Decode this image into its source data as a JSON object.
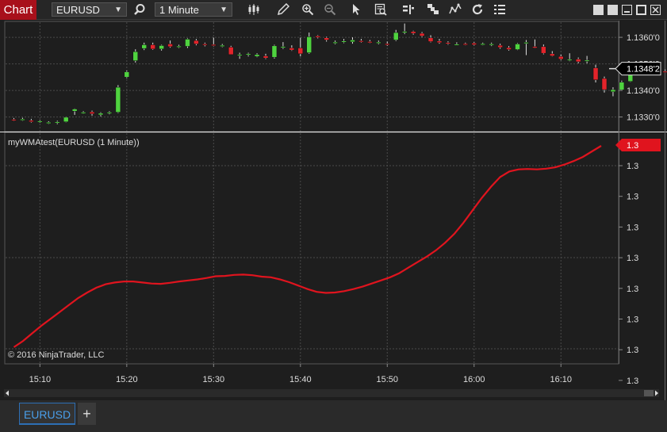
{
  "toolbar": {
    "chart_tab": "Chart",
    "instrument": "EURUSD",
    "interval": "1 Minute",
    "icons": [
      "search-icon",
      "bar-type-icon",
      "draw-tool-icon",
      "zoom-in-icon",
      "zoom-out-icon",
      "pointer-icon",
      "data-box-icon",
      "strategy-icon",
      "properties-icon",
      "indicator-icon",
      "reload-icon",
      "list-icon"
    ]
  },
  "window_buttons": [
    "restore-icon",
    "tile-icon",
    "minimize-icon",
    "maximize-icon",
    "close-icon"
  ],
  "chart_data": [
    {
      "type": "candlestick",
      "instrument": "EURUSD",
      "interval": "1 Minute",
      "price_axis": {
        "labels": [
          "1.1360'0",
          "1.1350'0",
          "1.1340'0",
          "1.1330'0"
        ],
        "values": [
          1.136,
          1.135,
          1.134,
          1.133
        ],
        "range": [
          1.13254,
          1.13654
        ],
        "current": 1.13482,
        "current_label": "1.1348'2"
      },
      "candles": [
        [
          1.13291,
          1.13296,
          1.13285,
          1.13288
        ],
        [
          1.1329,
          1.13297,
          1.13286,
          1.13292
        ],
        [
          1.13287,
          1.13293,
          1.13279,
          1.13282
        ],
        [
          1.13283,
          1.13289,
          1.13278,
          1.13285
        ],
        [
          1.13279,
          1.13284,
          1.13274,
          1.1328
        ],
        [
          1.13279,
          1.13286,
          1.13273,
          1.13282
        ],
        [
          1.13282,
          1.13301,
          1.1328,
          1.13299
        ],
        [
          1.13322,
          1.13332,
          1.13308,
          1.1333
        ],
        [
          1.13317,
          1.13322,
          1.13312,
          1.13318
        ],
        [
          1.13319,
          1.13324,
          1.13305,
          1.13312
        ],
        [
          1.13308,
          1.13318,
          1.13302,
          1.13314
        ],
        [
          1.13316,
          1.13322,
          1.1331,
          1.13318
        ],
        [
          1.13318,
          1.1342,
          1.13315,
          1.13412
        ],
        [
          1.1345,
          1.13475,
          1.13446,
          1.1347
        ],
        [
          1.13512,
          1.13555,
          1.13505,
          1.13546
        ],
        [
          1.13558,
          1.1358,
          1.13552,
          1.13572
        ],
        [
          1.13572,
          1.1358,
          1.13553,
          1.13556
        ],
        [
          1.13556,
          1.13572,
          1.1355,
          1.13569
        ],
        [
          1.13575,
          1.13588,
          1.13561,
          1.13565
        ],
        [
          1.13566,
          1.13572,
          1.1356,
          1.13567
        ],
        [
          1.13566,
          1.13596,
          1.1356,
          1.13593
        ],
        [
          1.13588,
          1.13594,
          1.1357,
          1.13575
        ],
        [
          1.13575,
          1.1358,
          1.13566,
          1.13572
        ],
        [
          1.13573,
          1.13599,
          1.13566,
          1.13569
        ],
        [
          1.13568,
          1.13575,
          1.13563,
          1.1357
        ],
        [
          1.13563,
          1.13568,
          1.13542,
          1.13535
        ],
        [
          1.13532,
          1.13542,
          1.13519,
          1.13535
        ],
        [
          1.13534,
          1.13542,
          1.13528,
          1.13538
        ],
        [
          1.13528,
          1.1354,
          1.13525,
          1.13535
        ],
        [
          1.1353,
          1.13538,
          1.13518,
          1.13522
        ],
        [
          1.13525,
          1.13572,
          1.1352,
          1.13568
        ],
        [
          1.13562,
          1.13582,
          1.13556,
          1.13565
        ],
        [
          1.1356,
          1.1357,
          1.13549,
          1.13552
        ],
        [
          1.1356,
          1.13599,
          1.13528,
          1.13538
        ],
        [
          1.13542,
          1.13618,
          1.13538,
          1.13602
        ],
        [
          1.13605,
          1.13608,
          1.13596,
          1.136
        ],
        [
          1.13598,
          1.13602,
          1.13584,
          1.1359
        ],
        [
          1.1358,
          1.13588,
          1.13574,
          1.13582
        ],
        [
          1.13584,
          1.13594,
          1.13578,
          1.13586
        ],
        [
          1.13583,
          1.136,
          1.13576,
          1.1359
        ],
        [
          1.13587,
          1.13594,
          1.1358,
          1.13584
        ],
        [
          1.13584,
          1.1359,
          1.13578,
          1.13583
        ],
        [
          1.1358,
          1.13588,
          1.13574,
          1.13582
        ],
        [
          1.13576,
          1.13584,
          1.13568,
          1.13575
        ],
        [
          1.1359,
          1.13628,
          1.13586,
          1.13618
        ],
        [
          1.13619,
          1.13652,
          1.13612,
          1.13622
        ],
        [
          1.13622,
          1.13625,
          1.1361,
          1.13615
        ],
        [
          1.13615,
          1.1362,
          1.13601,
          1.13605
        ],
        [
          1.13598,
          1.13608,
          1.13581,
          1.13584
        ],
        [
          1.13586,
          1.13594,
          1.13576,
          1.1358
        ],
        [
          1.1358,
          1.13585,
          1.13572,
          1.13576
        ],
        [
          1.13574,
          1.13581,
          1.1357,
          1.13574
        ],
        [
          1.13576,
          1.1358,
          1.1357,
          1.13573
        ],
        [
          1.13578,
          1.13582,
          1.13569,
          1.13572
        ],
        [
          1.13575,
          1.1358,
          1.1357,
          1.13576
        ],
        [
          1.13573,
          1.1358,
          1.13567,
          1.13575
        ],
        [
          1.1357,
          1.13576,
          1.13557,
          1.13562
        ],
        [
          1.13561,
          1.13567,
          1.1355,
          1.13554
        ],
        [
          1.13554,
          1.13578,
          1.13552,
          1.13575
        ],
        [
          1.1358,
          1.1359,
          1.13533,
          1.13581
        ],
        [
          1.13565,
          1.13592,
          1.13559,
          1.1356
        ],
        [
          1.13565,
          1.13573,
          1.13536,
          1.1354
        ],
        [
          1.13538,
          1.13548,
          1.13528,
          1.1353
        ],
        [
          1.13528,
          1.13535,
          1.13514,
          1.13518
        ],
        [
          1.13513,
          1.1354,
          1.1351,
          1.13517
        ],
        [
          1.13518,
          1.13524,
          1.13502,
          1.13508
        ],
        [
          1.1351,
          1.1353,
          1.13502,
          1.13514
        ],
        [
          1.13485,
          1.13497,
          1.1343,
          1.1344
        ],
        [
          1.13445,
          1.13452,
          1.13392,
          1.13403
        ],
        [
          1.13395,
          1.13412,
          1.13378,
          1.13403
        ],
        [
          1.13402,
          1.13437,
          1.13399,
          1.13431
        ],
        [
          1.13434,
          1.13476,
          1.13432,
          1.13473
        ],
        [
          1.13475,
          1.13487,
          1.13475,
          1.1348
        ],
        [
          1.13484,
          1.1349,
          1.13478,
          1.13486
        ],
        [
          1.13486,
          1.13492,
          1.1347,
          1.13473
        ],
        [
          1.13472,
          1.13479,
          1.13466,
          1.13471
        ],
        [
          1.13471,
          1.13478,
          1.1346,
          1.13465
        ],
        [
          1.13465,
          1.1348,
          1.13462,
          1.13476
        ],
        [
          1.13471,
          1.13479,
          1.13468,
          1.13474
        ],
        [
          1.13476,
          1.13485,
          1.13472,
          1.1348
        ],
        [
          1.1348,
          1.13486,
          1.13476,
          1.13482
        ]
      ],
      "colors": {
        "up": "#4fd33f",
        "down": "#e3242b",
        "wick": "#e0e0e0",
        "current_tag": "#000000"
      }
    },
    {
      "type": "line",
      "label": "myWMAtest(EURUSD (1 Minute))",
      "value_axis": {
        "labels": [
          "1.3",
          "1.3",
          "1.3",
          "1.3",
          "1.3",
          "1.3",
          "1.3",
          "1.3"
        ],
        "current_label": "1.3"
      },
      "color": "#e0141e",
      "values": [
        0.0,
        0.09,
        0.2,
        0.31,
        0.41,
        0.51,
        0.61,
        0.71,
        0.79,
        0.86,
        0.91,
        0.935,
        0.95,
        0.95,
        0.935,
        0.92,
        0.915,
        0.93,
        0.95,
        0.965,
        0.98,
        1.0,
        1.025,
        1.03,
        1.045,
        1.05,
        1.04,
        1.02,
        1.01,
        0.98,
        0.94,
        0.89,
        0.84,
        0.8,
        0.785,
        0.79,
        0.81,
        0.84,
        0.875,
        0.92,
        0.965,
        1.01,
        1.07,
        1.15,
        1.23,
        1.31,
        1.4,
        1.51,
        1.64,
        1.8,
        1.98,
        2.16,
        2.32,
        2.46,
        2.54,
        2.57,
        2.575,
        2.57,
        2.58,
        2.6,
        2.64,
        2.69,
        2.75,
        2.83,
        2.91
      ],
      "y_range": [
        0,
        2.91
      ]
    }
  ],
  "time_axis": {
    "labels": [
      "15:10",
      "15:20",
      "15:30",
      "15:40",
      "15:50",
      "16:00",
      "16:10"
    ],
    "first_minute": 7,
    "last_minute": 75,
    "first_label_minute": 10
  },
  "copyright": "© 2016 NinjaTrader, LLC",
  "tabs": {
    "active": "EURUSD",
    "add": "+"
  }
}
